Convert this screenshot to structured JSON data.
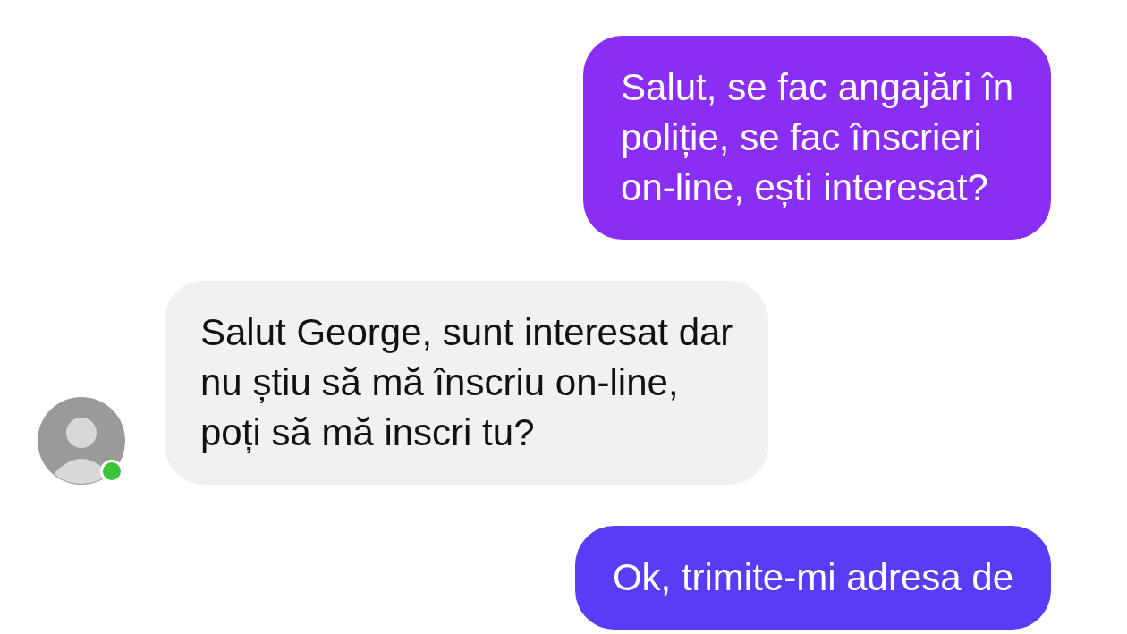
{
  "messages": [
    {
      "kind": "sent",
      "color": "#8a2ef5",
      "text": "Salut, se fac angajări în\npoliție, se fac înscrieri\non-line, ești interesat?"
    },
    {
      "kind": "received",
      "color": "#f1f1f3",
      "text": "Salut George, sunt interesat dar\nnu știu să mă înscriu on-line,\npoți să mă inscri tu?",
      "avatar": {
        "online": true
      }
    },
    {
      "kind": "sent",
      "color": "#5a3cf6",
      "text": "Ok, trimite-mi adresa de"
    }
  ]
}
